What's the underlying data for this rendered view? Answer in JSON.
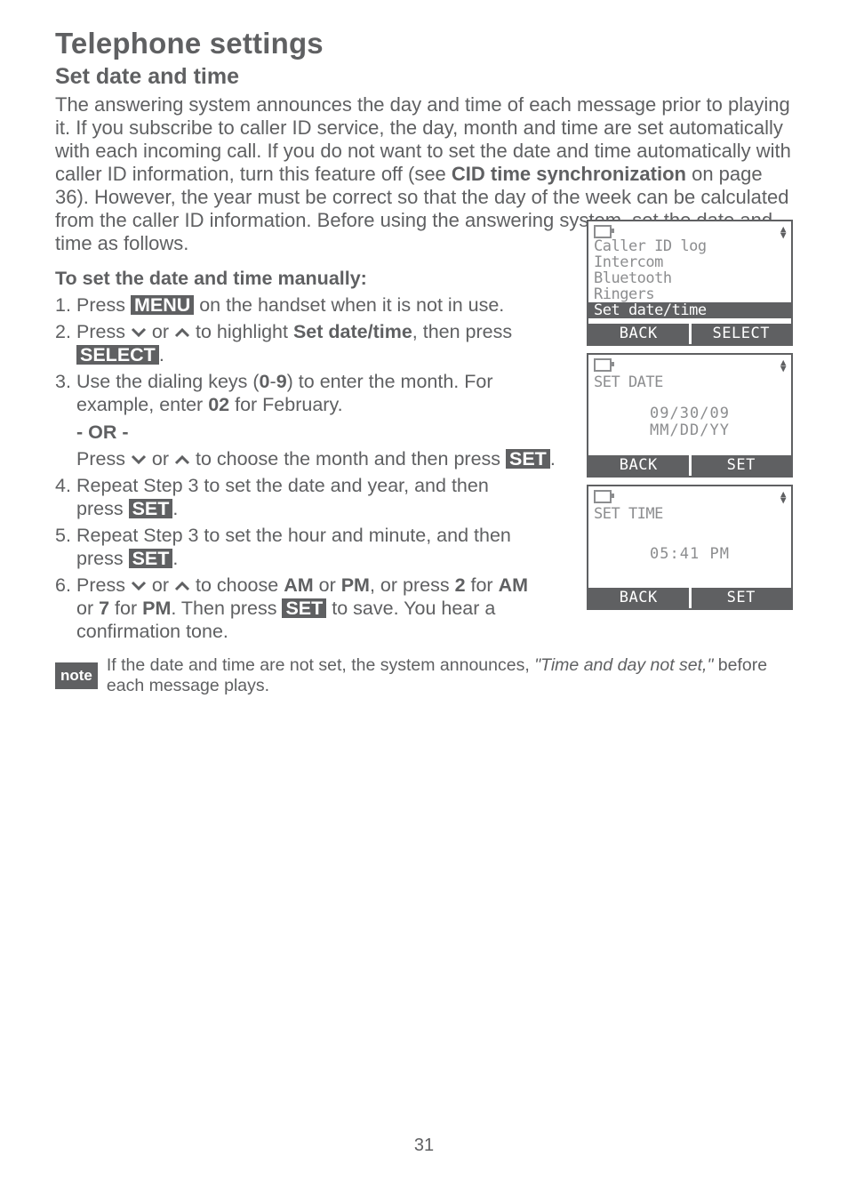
{
  "page_number": "31",
  "h1": "Telephone settings",
  "h2": "Set date and time",
  "intro_a": "The answering system announces the day and time of each message prior to playing it. If you subscribe to caller ID service, the day, month and time are set automatically with each incoming call. If you do not want to set the date and time automatically with caller ID information, turn this feature off (see ",
  "intro_b": "CID time synchronization",
  "intro_c": " on page 36). However, the year must be correct so that the day of the week can be calculated from the caller ID information. Before using the answering system, set the date and time as follows.",
  "h3": "To set the date and time manually:",
  "steps": {
    "s1_a": "Press ",
    "s1_btn": "MENU",
    "s1_b": " on the handset when it is not in use.",
    "s2_a": "Press ",
    "s2_b": " or ",
    "s2_c": " to highlight ",
    "s2_d": "Set date/time",
    "s2_e": ", then press ",
    "s2_btn": "SELECT",
    "s2_f": ".",
    "s3_a": "Use the dialing keys (",
    "s3_b": "0",
    "s3_c": "-",
    "s3_d": "9",
    "s3_e": ") to enter the month. For example, enter ",
    "s3_f": "02",
    "s3_g": " for February.",
    "or": "- OR -",
    "s3x_a": "Press ",
    "s3x_b": " or ",
    "s3x_c": " to choose the month and then press ",
    "s3x_btn": "SET",
    "s3x_d": ".",
    "s4_a": "Repeat Step 3 to set the date and year, and then press ",
    "s4_btn": "SET",
    "s4_b": ".",
    "s5_a": "Repeat Step 3 to set the hour and minute, and then press ",
    "s5_btn": "SET",
    "s5_b": ".",
    "s6_a": "Press ",
    "s6_b": " or ",
    "s6_c": " to choose ",
    "s6_d": "AM",
    "s6_e": " or ",
    "s6_f": "PM",
    "s6_g": ", or press ",
    "s6_h": "2",
    "s6_i": " for ",
    "s6_j": "AM",
    "s6_k": " or ",
    "s6_l": "7",
    "s6_m": " for ",
    "s6_n": "PM",
    "s6_o": ". Then press ",
    "s6_btn": "SET",
    "s6_p": " to save. You hear a confirmation tone."
  },
  "note": {
    "badge": "note",
    "a": "If the date and time are not set, the system announces, ",
    "b": "\"Time and day not set,\"",
    "c": " before each message plays."
  },
  "screen1": {
    "l1": "Caller ID log",
    "l2": "Intercom",
    "l3": "Bluetooth",
    "l4": "Ringers",
    "hl": "Set date/time",
    "sk_l": "BACK",
    "sk_r": "SELECT"
  },
  "screen2": {
    "title": "SET DATE",
    "line1": "09/30/09",
    "line2": "MM/DD/YY",
    "sk_l": "BACK",
    "sk_r": "SET"
  },
  "screen3": {
    "title": "SET TIME",
    "line1": "05:41 PM",
    "sk_l": "BACK",
    "sk_r": "SET"
  }
}
